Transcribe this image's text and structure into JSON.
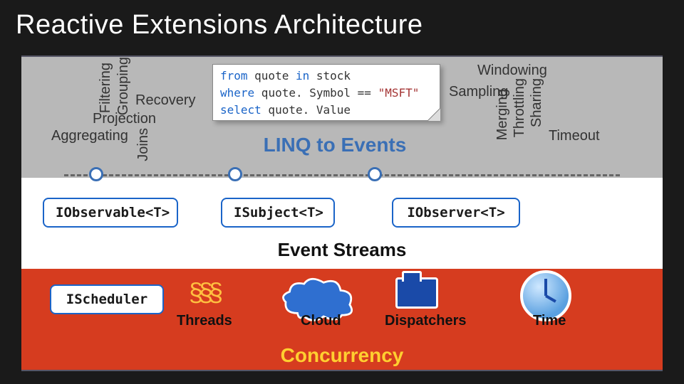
{
  "title": "Reactive Extensions Architecture",
  "top": {
    "linq_label": "LINQ to Events",
    "code": {
      "line1a": "from",
      "line1b": " quote ",
      "line1c": "in",
      "line1d": " stock",
      "line2a": "where",
      "line2b": " quote. Symbol == ",
      "line2c": "\"MSFT\"",
      "line3a": "select",
      "line3b": " quote. Value"
    },
    "left": {
      "filtering": "Filtering",
      "grouping": "Grouping",
      "recovery": "Recovery",
      "projection": "Projection",
      "aggregating": "Aggregating",
      "joins": "Joins"
    },
    "right": {
      "windowing": "Windowing",
      "sampling": "Sampling",
      "sharing": "Sharing",
      "throttling": "Throttling",
      "merging": "Merging",
      "timeout": "Timeout"
    }
  },
  "mid": {
    "iobservable": "IObservable<T>",
    "isubject": "ISubject<T>",
    "iobserver": "IObserver<T>",
    "title": "Event Streams"
  },
  "bot": {
    "ischeduler": "IScheduler",
    "threads": "Threads",
    "cloud": "Cloud",
    "dispatchers": "Dispatchers",
    "time": "Time",
    "title": "Concurrency"
  }
}
